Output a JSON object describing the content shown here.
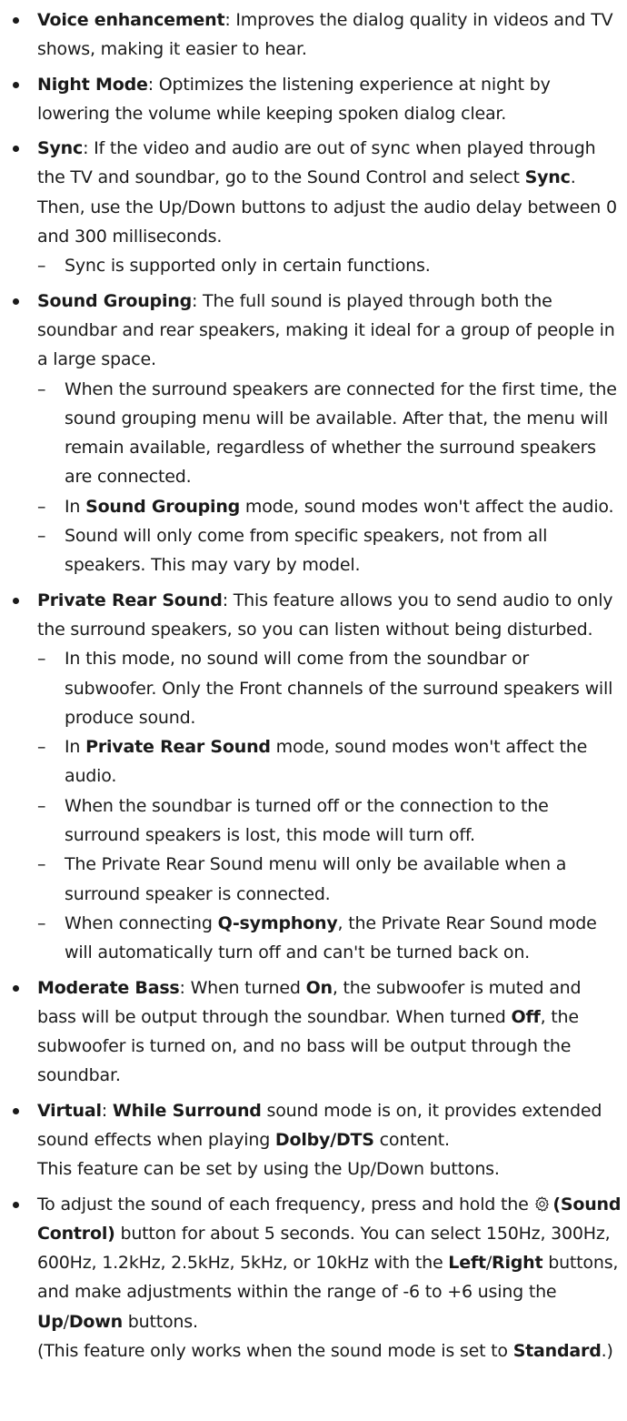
{
  "items": [
    {
      "title": "Voice enhancement",
      "text": ": Improves the dialog quality in videos and TV shows, making it easier to hear."
    },
    {
      "title": "Night Mode",
      "text": ": Optimizes the listening experience at night by lowering the volume while keeping spoken dialog clear."
    },
    {
      "title": "Sync",
      "text1": ": If the video and audio are out of sync when played through the TV and soundbar, go to the Sound Control and select ",
      "bold1": "Sync",
      "text2": ". Then, use the Up/Down buttons to adjust the audio delay between 0 and 300 milliseconds.",
      "notes": [
        "Sync is supported only in certain functions."
      ]
    },
    {
      "title": "Sound Grouping",
      "text": ": The full sound is played through both the soundbar and rear speakers, making it ideal for a group of people in a large space.",
      "note1": "When the surround speakers are connected for the first time, the sound grouping menu will be available. After that, the menu will remain available, regardless of whether the surround speakers are connected.",
      "note2_pre": "In ",
      "note2_bold": "Sound Grouping",
      "note2_post": " mode, sound modes won't affect the audio.",
      "note3": "Sound will only come from specific speakers, not from all speakers. This may vary by model."
    },
    {
      "title": "Private Rear Sound",
      "text": ": This feature allows you to send audio to only the surround speakers, so you can listen without being disturbed.",
      "note1": "In this mode, no sound will come from the soundbar or subwoofer. Only the Front channels of the surround speakers will produce sound.",
      "note2_pre": "In ",
      "note2_bold": "Private Rear Sound",
      "note2_post": " mode, sound modes won't affect the audio.",
      "note3": "When the soundbar is turned off or the connection to the surround speakers is lost, this mode will turn off.",
      "note4": "The Private Rear Sound menu will only be available when a surround speaker is connected.",
      "note5_pre": "When connecting ",
      "note5_bold": "Q-symphony",
      "note5_post": ", the Private Rear Sound mode will automatically turn off and can't be turned back on."
    },
    {
      "title": "Moderate Bass",
      "t1": ": When turned ",
      "b1": "On",
      "t2": ", the subwoofer is muted and bass will be output through the soundbar. When turned ",
      "b2": "Off",
      "t3": ", the subwoofer is turned on, and no bass will be output through the soundbar."
    },
    {
      "title": "Virtual",
      "t1": ": ",
      "b1": "While Surround",
      "t2": " sound mode is on, it provides extended sound effects when playing ",
      "b2": "Dolby/DTS",
      "t3": " content.",
      "line2": "This feature can be set by using the Up/Down buttons."
    },
    {
      "t1": "To adjust the sound of each frequency, press and hold the ",
      "icon": "gear-icon",
      "b1": "(Sound Control)",
      "t2": " button for about 5 seconds. You can select 150Hz, 300Hz, 600Hz, 1.2kHz, 2.5kHz, 5kHz, or 10kHz with the ",
      "b2": "Left",
      "t3": "/",
      "b3": "Right",
      "t4": " buttons, and make adjustments within the range of -6 to +6 using the ",
      "b4": "Up",
      "t5": "/",
      "b5": "Down",
      "t6": " buttons.",
      "p_pre": "(This feature only works when the sound mode is set to ",
      "p_bold": "Standard",
      "p_post": ".)"
    }
  ]
}
